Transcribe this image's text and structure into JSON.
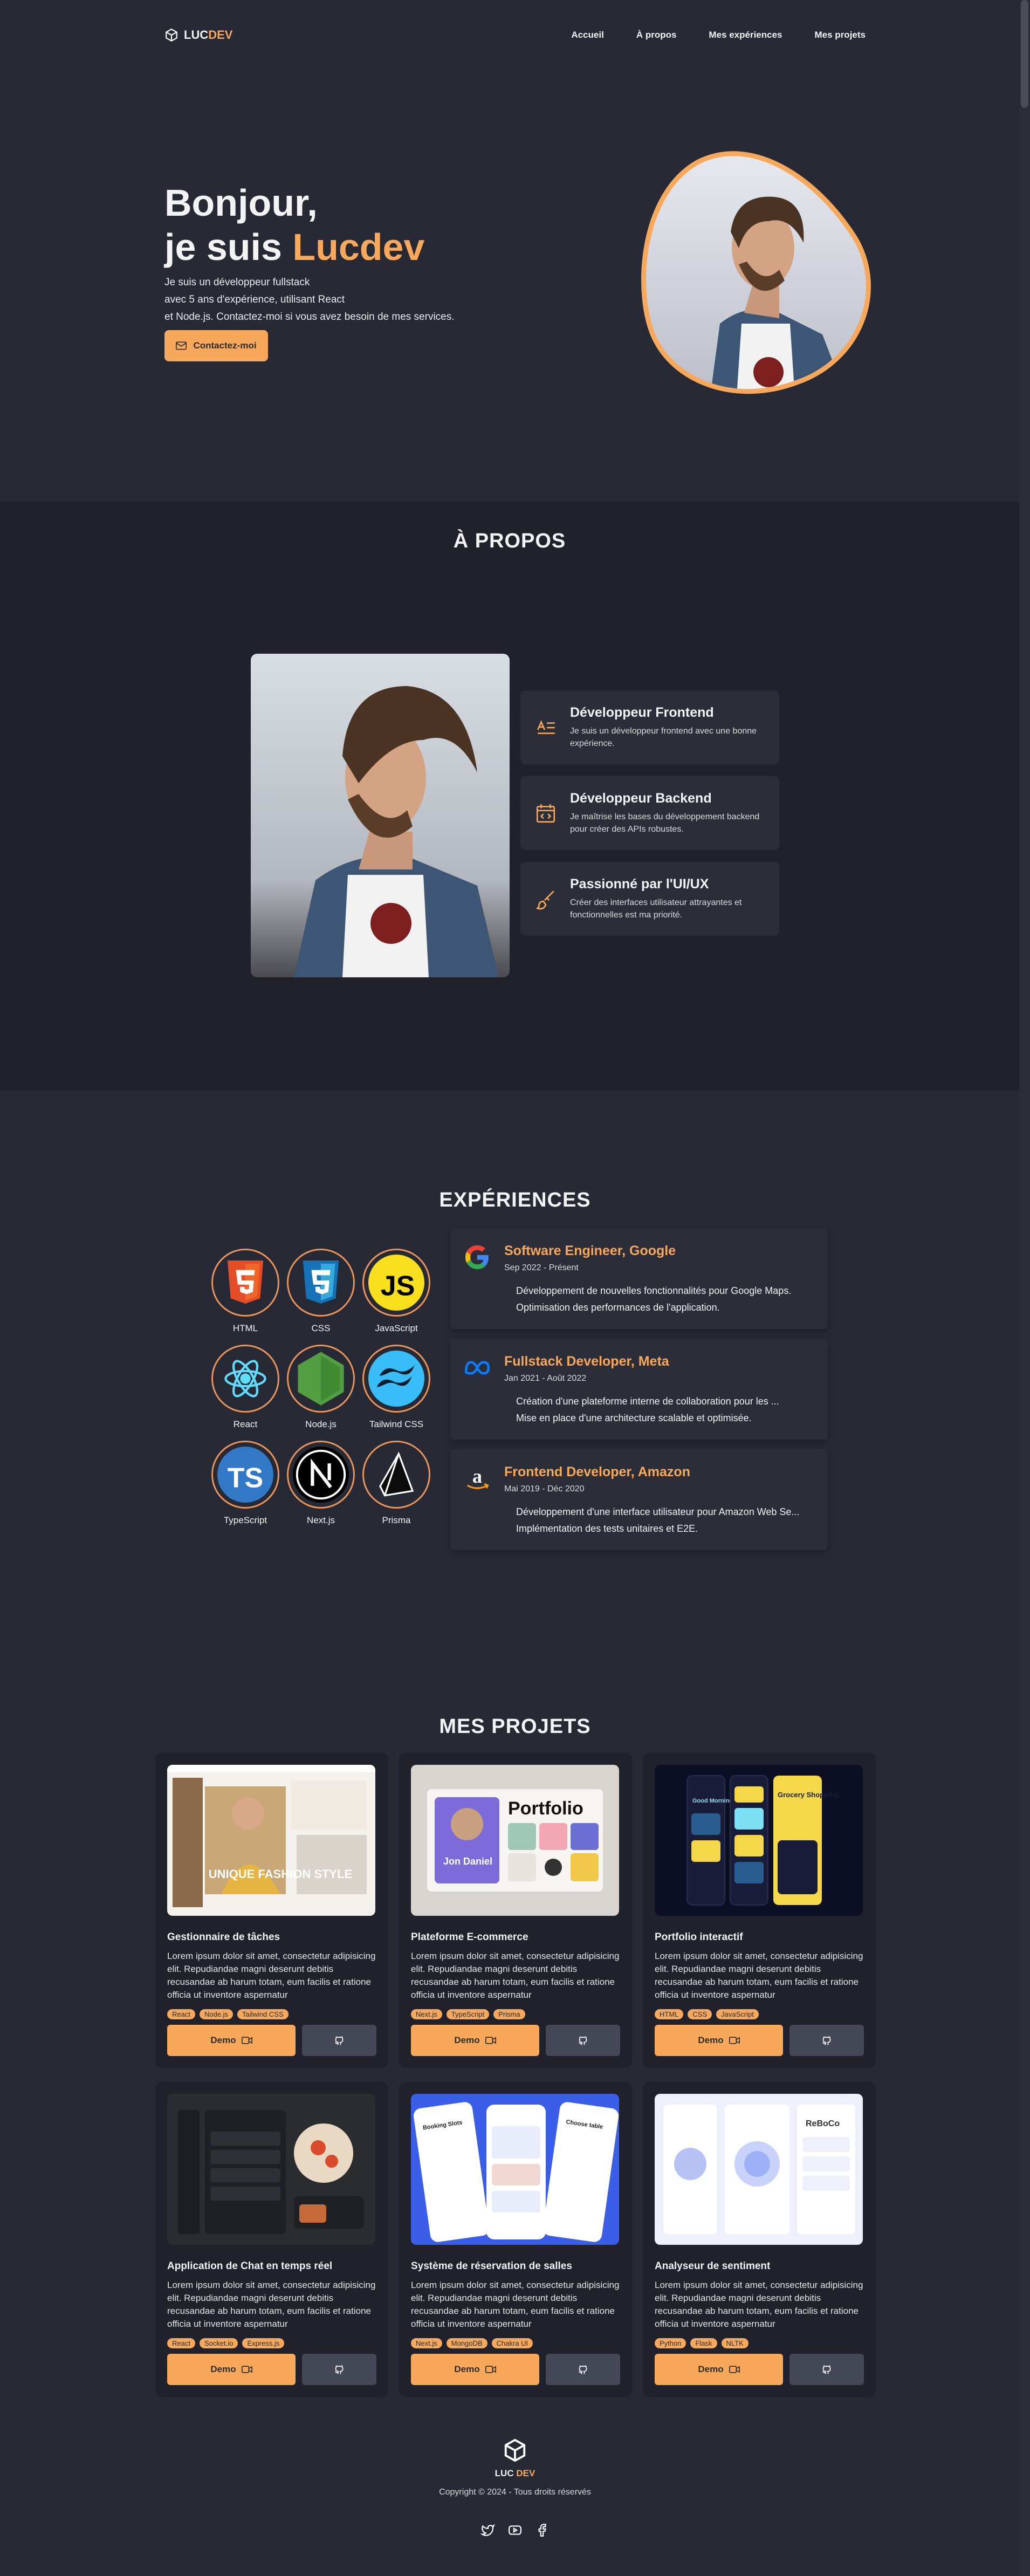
{
  "nav": {
    "logo_prefix": "LUC",
    "logo_suffix": "DEV",
    "links": [
      "Accueil",
      "À propos",
      "Mes expériences",
      "Mes projets"
    ]
  },
  "hero": {
    "greeting": "Bonjour,",
    "name_prefix": "je suis ",
    "name": "Lucdev",
    "intro_lines": [
      "Je suis un développeur fullstack",
      "avec 5 ans d'expérience, utilisant React",
      "et Node.js. Contactez-moi si vous avez besoin de mes services."
    ],
    "contact_label": "Contactez-moi"
  },
  "about": {
    "title": "À PROPOS",
    "cards": [
      {
        "icon": "frontend-icon",
        "title": "Développeur Frontend",
        "text": "Je suis un développeur frontend avec une bonne expérience."
      },
      {
        "icon": "calendar-code-icon",
        "title": "Développeur Backend",
        "text": "Je maîtrise les bases du développement backend pour créer des APIs robustes."
      },
      {
        "icon": "brush-icon",
        "title": "Passionné par l'UI/UX",
        "text": "Créer des interfaces utilisateur attrayantes et fonctionnelles est ma priorité."
      }
    ]
  },
  "experiences": {
    "title": "EXPÉRIENCES",
    "skills": [
      "HTML",
      "CSS",
      "JavaScript",
      "React",
      "Node.js",
      "Tailwind CSS",
      "TypeScript",
      "Next.js",
      "Prisma"
    ],
    "jobs": [
      {
        "logo": "google-icon",
        "title": "Software Engineer, Google",
        "date": "Sep 2022 - Présent",
        "points": [
          "Développement de nouvelles fonctionnalités pour Google Maps.",
          "Optimisation des performances de l'application."
        ]
      },
      {
        "logo": "meta-icon",
        "title": "Fullstack Developer, Meta",
        "date": "Jan 2021 - Août 2022",
        "points": [
          "Création d'une plateforme interne de collaboration pour les ...",
          "Mise en place d'une architecture scalable et optimisée."
        ]
      },
      {
        "logo": "amazon-icon",
        "title": "Frontend Developer, Amazon",
        "date": "Mai 2019 - Déc 2020",
        "points": [
          "Développement d'une interface utilisateur pour Amazon Web Se...",
          "Implémentation des tests unitaires et E2E."
        ]
      }
    ]
  },
  "projects": {
    "title": "MES PROJETS",
    "demo_label": "Demo",
    "description": "Lorem ipsum dolor sit amet, consectetur adipisicing elit. Repudiandae magni deserunt debitis recusandae ab harum totam, eum facilis et ratione officia ut inventore aspernatur",
    "items": [
      {
        "title": "Gestionnaire de tâches",
        "tags": [
          "React",
          "Node.js",
          "Tailwind CSS"
        ],
        "image": "fashion-site"
      },
      {
        "title": "Plateforme E-commerce",
        "tags": [
          "Next.js",
          "TypeScript",
          "Prisma"
        ],
        "image": "portfolio-site"
      },
      {
        "title": "Portfolio interactif",
        "tags": [
          "HTML",
          "CSS",
          "JavaScript"
        ],
        "image": "mobile-app-dark"
      },
      {
        "title": "Application de Chat en temps réel",
        "tags": [
          "React",
          "Socket.io",
          "Express.js"
        ],
        "image": "food-app-dark"
      },
      {
        "title": "Système de réservation de salles",
        "tags": [
          "Next.js",
          "MongoDB",
          "Chakra UI"
        ],
        "image": "booking-app-blue"
      },
      {
        "title": "Analyseur de sentiment",
        "tags": [
          "Python",
          "Flask",
          "NLTK"
        ],
        "image": "dashboard-light"
      }
    ],
    "mockup_text": {
      "fashion": "UNIQUE FASHION STYLE",
      "portfolio": "Portfolio",
      "portfolio_name": "Jon Daniel",
      "morning": "Good Morning",
      "grocery": "Grocery Shopping",
      "booking": "Booking Slots",
      "choose": "Choose table",
      "brand": "ReBoCo"
    }
  },
  "footer": {
    "logo_prefix": "LUC ",
    "logo_suffix": "DEV",
    "copyright": "Copyright © 2024 - Tous droits réservés",
    "social": [
      "twitter-icon",
      "youtube-icon",
      "facebook-icon"
    ]
  },
  "colors": {
    "background": "#272935",
    "section_dark": "#20212b",
    "card": "#2b2d39",
    "accent": "#f7a85b"
  }
}
